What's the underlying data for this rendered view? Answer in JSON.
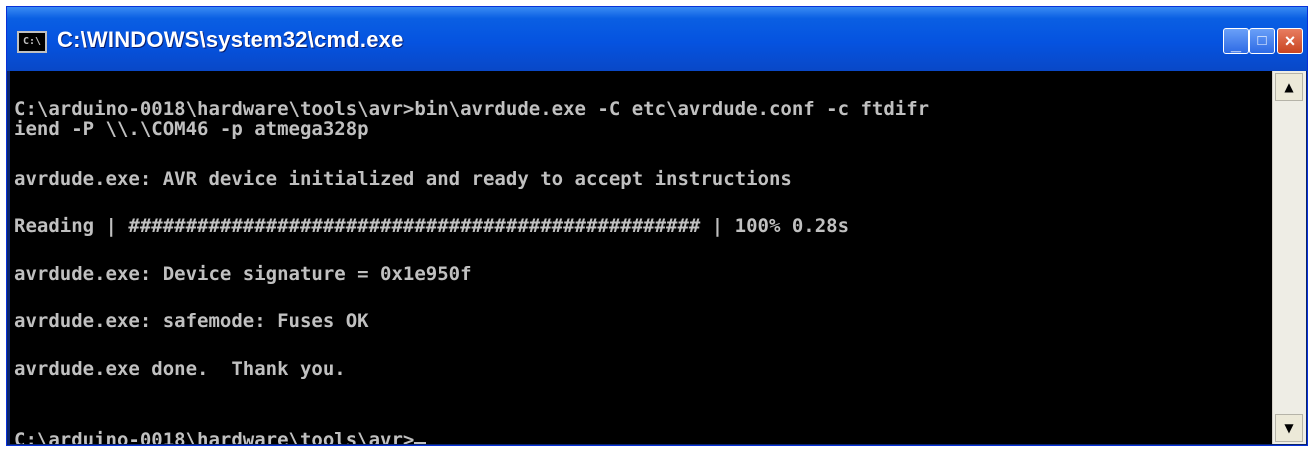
{
  "window": {
    "title": "C:\\WINDOWS\\system32\\cmd.exe",
    "icon": "cmd-icon"
  },
  "console": {
    "lines": [
      "C:\\arduino-0018\\hardware\\tools\\avr>bin\\avrdude.exe -C etc\\avrdude.conf -c ftdifr",
      "iend -P \\\\.\\COM46 -p atmega328p",
      "avrdude.exe: AVR device initialized and ready to accept instructions",
      "Reading | ################################################## | 100% 0.28s",
      "avrdude.exe: Device signature = 0x1e950f",
      "avrdude.exe: safemode: Fuses OK",
      "avrdude.exe done.  Thank you.",
      "C:\\arduino-0018\\hardware\\tools\\avr>"
    ]
  },
  "controls": {
    "minimize": "_",
    "maximize": "□",
    "close": "×"
  },
  "scrollbar": {
    "up": "▲",
    "down": "▼"
  }
}
